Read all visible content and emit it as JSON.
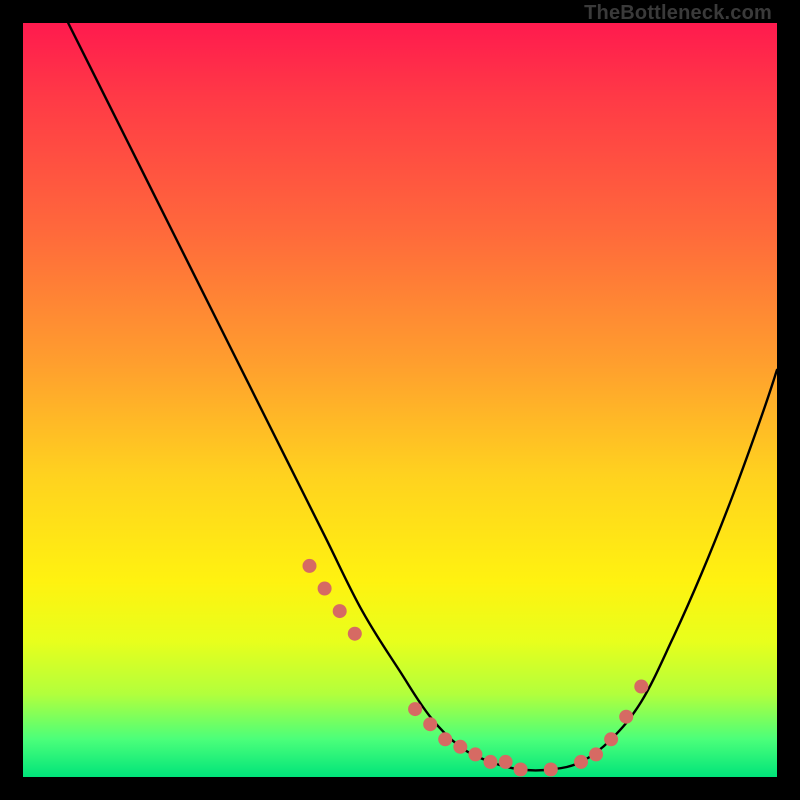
{
  "attribution": "TheBottleneck.com",
  "colors": {
    "background": "#000000",
    "gradient_top": "#ff1a4e",
    "gradient_mid1": "#ff9e2e",
    "gradient_mid2": "#fff210",
    "gradient_bottom": "#00e47a",
    "curve": "#000000",
    "marker": "#d66a63"
  },
  "chart_data": {
    "type": "line",
    "title": "",
    "xlabel": "",
    "ylabel": "",
    "xlim": [
      0,
      100
    ],
    "ylim": [
      0,
      100
    ],
    "grid": false,
    "legend": false,
    "series": [
      {
        "name": "bottleneck-curve",
        "x": [
          6,
          10,
          15,
          20,
          25,
          30,
          35,
          40,
          45,
          50,
          54,
          58,
          62,
          66,
          70,
          74,
          78,
          82,
          86,
          90,
          94,
          98,
          100
        ],
        "values": [
          100,
          92,
          82,
          72,
          62,
          52,
          42,
          32,
          22,
          14,
          8,
          4,
          2,
          1,
          1,
          2,
          5,
          10,
          18,
          27,
          37,
          48,
          54
        ]
      }
    ],
    "markers": {
      "name": "highlighted-points",
      "x": [
        38,
        40,
        42,
        44,
        52,
        54,
        56,
        58,
        60,
        62,
        64,
        66,
        70,
        74,
        76,
        78,
        80,
        82
      ],
      "values": [
        28,
        25,
        22,
        19,
        9,
        7,
        5,
        4,
        3,
        2,
        2,
        1,
        1,
        2,
        3,
        5,
        8,
        12
      ]
    }
  }
}
